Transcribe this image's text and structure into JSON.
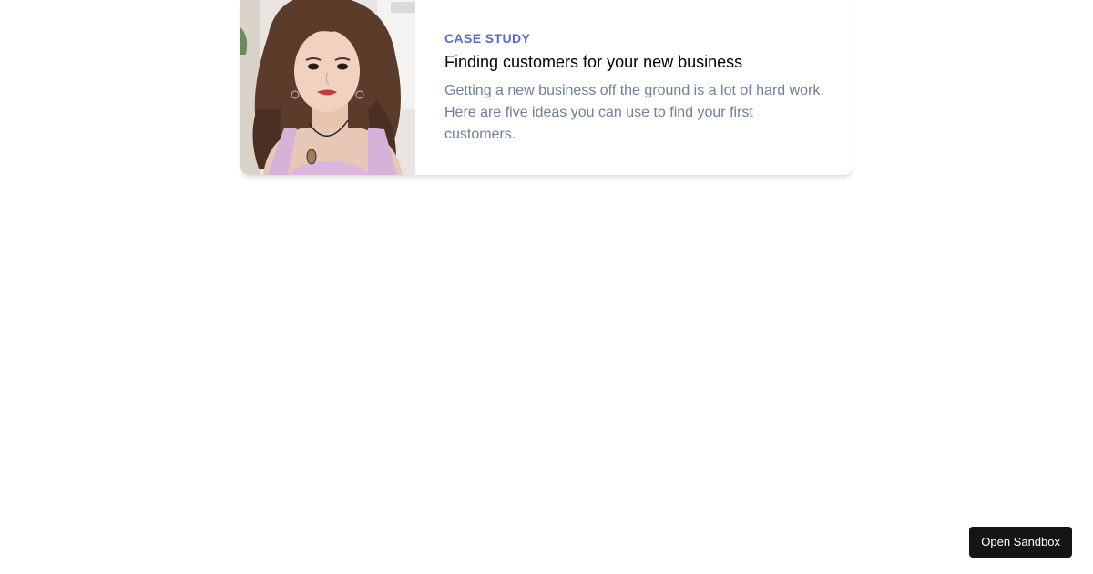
{
  "card": {
    "eyebrow": "Case Study",
    "title": "Finding customers for your new business",
    "description": "Getting a new business off the ground is a lot of hard work. Here are five ideas you can use to find your first customers."
  },
  "sandbox": {
    "button_label": "Open Sandbox"
  },
  "colors": {
    "accent": "#5a67d8",
    "text_muted": "#718096",
    "button_bg": "#151515"
  }
}
